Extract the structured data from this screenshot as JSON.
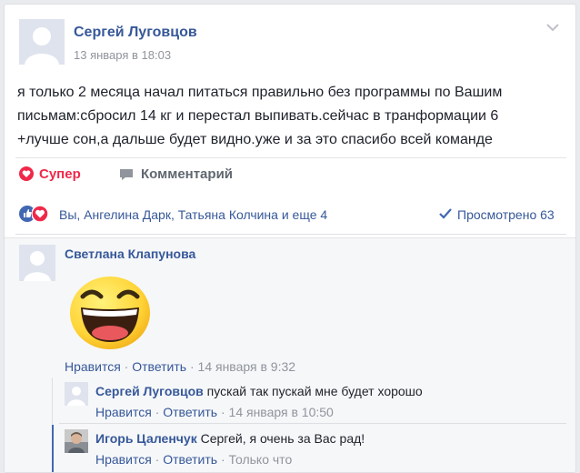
{
  "post": {
    "author": "Сергей Луговцов",
    "timestamp": "13 января в 18:03",
    "text_lines": [
      "я только 2 месяца начал питаться правильно без программы по Вашим",
      "письмам:сбросил 14 кг и перестал выпивать.сейчас в транформации 6",
      "+лучше сон,а дальше будет видно.уже и за это спасибо всей команде"
    ]
  },
  "actions": {
    "super_label": "Супер",
    "comment_label": "Комментарий"
  },
  "reactions": {
    "summary": "Вы, Ангелина Дарк, Татьяна Колчина и еще 4",
    "seen": "Просмотрено 63"
  },
  "comments": [
    {
      "author": "Светлана Клапунова",
      "text": "",
      "like": "Нравится",
      "reply": "Ответить",
      "time": "14 января в 9:32"
    },
    {
      "author": "Сергей Луговцов",
      "text": "пускай так пускай мне будет хорошо",
      "like": "Нравится",
      "reply": "Ответить",
      "time": "14 января в 10:50"
    },
    {
      "author": "Игорь Цаленчук",
      "text": "Сергей, я очень за Вас рад!",
      "like": "Нравится",
      "reply": "Ответить",
      "time": "Только что"
    }
  ],
  "separator": "·",
  "colors": {
    "link": "#365899",
    "super": "#f0284a",
    "gray": "#90949c",
    "like": "#4267b2"
  }
}
